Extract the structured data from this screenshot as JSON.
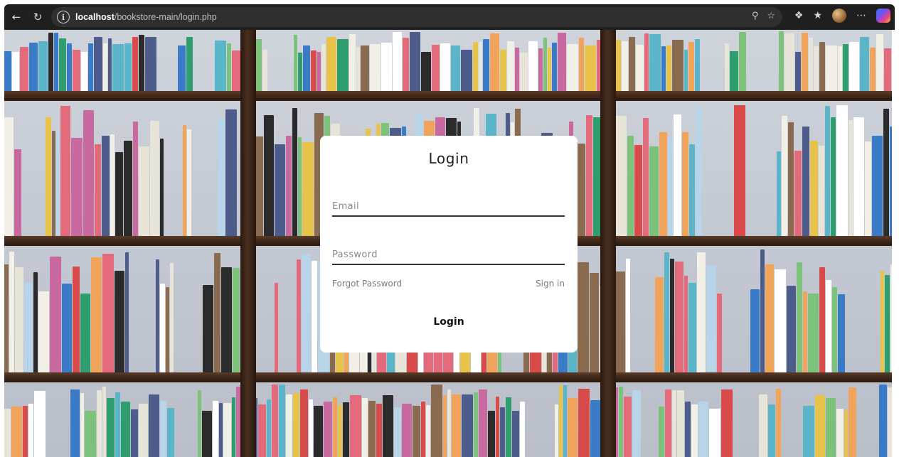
{
  "browser": {
    "url_host": "localhost",
    "url_path": "/bookstore-main/login.php",
    "icons": [
      "back-icon",
      "reload-icon",
      "info-icon",
      "key-icon",
      "favorite-star-icon",
      "extensions-icon",
      "favorites-icon",
      "profile-avatar",
      "more-icon",
      "copilot-icon"
    ]
  },
  "login": {
    "title": "Login",
    "email_placeholder": "Email",
    "password_placeholder": "Password",
    "forgot_password": "Forgot Password",
    "sign_in": "Sign in",
    "button": "Login"
  },
  "colors": {
    "card_background": "#ffffff",
    "underline": "#333333",
    "link_text": "#7a7a7a",
    "chrome_background": "#1f1f1f",
    "shelf_wood": "#3b2418"
  }
}
